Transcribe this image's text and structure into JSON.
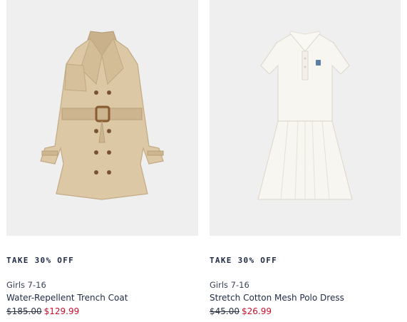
{
  "products": [
    {
      "promo": "TAKE 30% OFF",
      "category": "Girls 7-16",
      "title": "Water-Repellent Trench Coat",
      "original_price": "$185.00",
      "sale_price": "$129.99",
      "image_icon": "trench-coat",
      "image_color": "#dcc8a4"
    },
    {
      "promo": "TAKE 30% OFF",
      "category": "Girls 7-16",
      "title": "Stretch Cotton Mesh Polo Dress",
      "original_price": "$45.00",
      "sale_price": "$26.99",
      "image_icon": "polo-dress",
      "image_color": "#f8f6f0"
    }
  ],
  "colors": {
    "sale": "#c8102e",
    "text": "#1f2a44",
    "image_bg": "#efefef"
  }
}
